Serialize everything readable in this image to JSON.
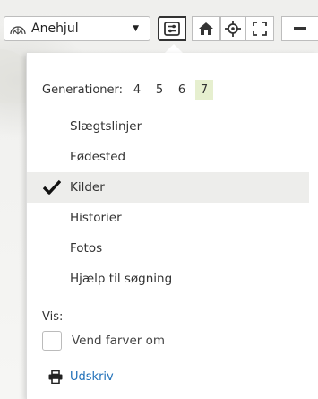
{
  "toolbar": {
    "chart_select_label": "Anehjul",
    "buttons": [
      "settings-icon",
      "home-icon",
      "center-icon",
      "fullscreen-icon",
      "minus-icon"
    ]
  },
  "panel": {
    "generations_label": "Generationer:",
    "generations": [
      "4",
      "5",
      "6",
      "7"
    ],
    "active_generation": "7",
    "menu_items": [
      {
        "label": "Slægtslinjer",
        "checked": false
      },
      {
        "label": "Fødested",
        "checked": false
      },
      {
        "label": "Kilder",
        "checked": true
      },
      {
        "label": "Historier",
        "checked": false
      },
      {
        "label": "Fotos",
        "checked": false
      },
      {
        "label": "Hjælp til søgning",
        "checked": false
      }
    ],
    "show_label": "Vis:",
    "invert_colors_label": "Vend farver om",
    "print_label": "Udskriv"
  },
  "colors": {
    "active_generation_bg": "#e6efcf",
    "selected_row_bg": "#ededeb",
    "link": "#1e6fb8"
  }
}
